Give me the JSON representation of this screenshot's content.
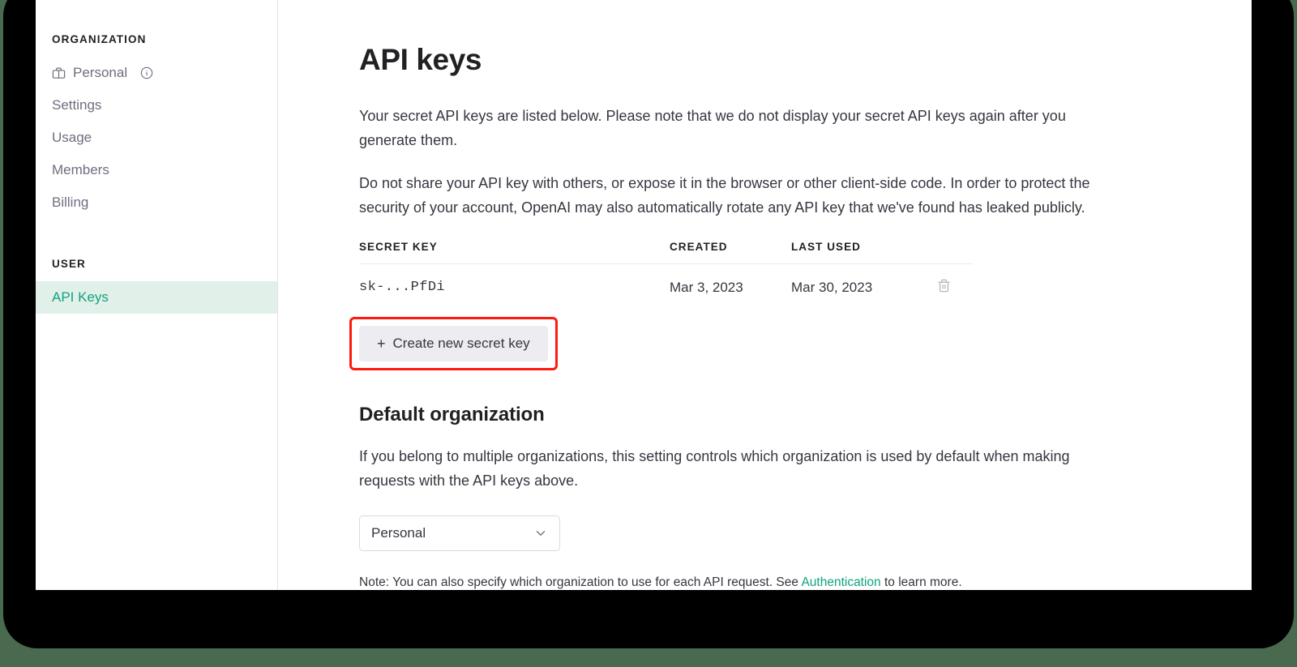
{
  "sidebar": {
    "organization_heading": "ORGANIZATION",
    "user_heading": "USER",
    "org_items": [
      {
        "label": "Personal",
        "icon": "briefcase-icon",
        "info_icon": "info-icon"
      },
      {
        "label": "Settings"
      },
      {
        "label": "Usage"
      },
      {
        "label": "Members"
      },
      {
        "label": "Billing"
      }
    ],
    "user_items": [
      {
        "label": "API Keys",
        "active": true
      }
    ],
    "active_color": "#10a37f",
    "active_bg": "#e2f0ea"
  },
  "main": {
    "title": "API keys",
    "paragraph_1": "Your secret API keys are listed below. Please note that we do not display your secret API keys again after you generate them.",
    "paragraph_2": "Do not share your API key with others, or expose it in the browser or other client-side code. In order to protect the security of your account, OpenAI may also automatically rotate any API key that we've found has leaked publicly.",
    "table": {
      "headers": [
        "SECRET KEY",
        "CREATED",
        "LAST USED",
        ""
      ],
      "rows": [
        {
          "secret_key": "sk-...PfDi",
          "created": "Mar 3, 2023",
          "last_used": "Mar 30, 2023",
          "delete_icon": "trash-icon"
        }
      ]
    },
    "create_key_button": {
      "label": "Create new secret key",
      "plus": "+",
      "highlighted": true,
      "highlight_color": "#ff1a0f"
    },
    "default_org": {
      "title": "Default organization",
      "description": "If you belong to multiple organizations, this setting controls which organization is used by default when making requests with the API keys above.",
      "select_value": "Personal",
      "chevron_icon": "chevron-down-icon",
      "note_prefix": "Note: You can also specify which organization to use for each API request. See ",
      "note_link": "Authentication",
      "note_suffix": " to learn more."
    }
  }
}
